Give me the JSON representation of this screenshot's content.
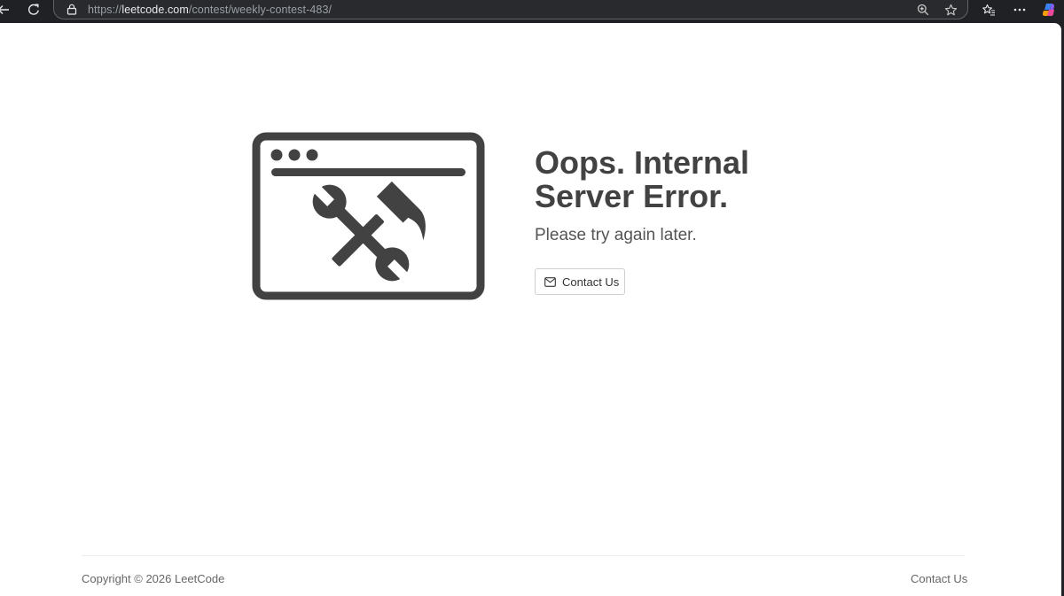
{
  "browser": {
    "url_prefix": "https://",
    "url_host": "leetcode.com",
    "url_path": "/contest/weekly-contest-483/"
  },
  "error": {
    "title_line1": "Oops. Internal",
    "title_line2": "Server Error.",
    "subtitle": "Please try again later.",
    "contact_button_label": "Contact Us"
  },
  "footer": {
    "copyright": "Copyright © 2026 LeetCode",
    "contact_link": "Contact Us"
  },
  "icons": {
    "back": "arrow-left-icon",
    "reload": "reload-icon",
    "lock": "lock-icon",
    "zoom": "zoom-icon",
    "favorite": "star-icon",
    "favorites_list": "favorites-icon",
    "more": "more-icon",
    "copilot": "copilot-icon",
    "illustration": "maintenance-window-icon",
    "mail": "mail-icon"
  },
  "colors": {
    "toolbar_bg": "#202124",
    "page_bg": "#ffffff",
    "illustration": "#424242",
    "title_text": "#424242"
  }
}
